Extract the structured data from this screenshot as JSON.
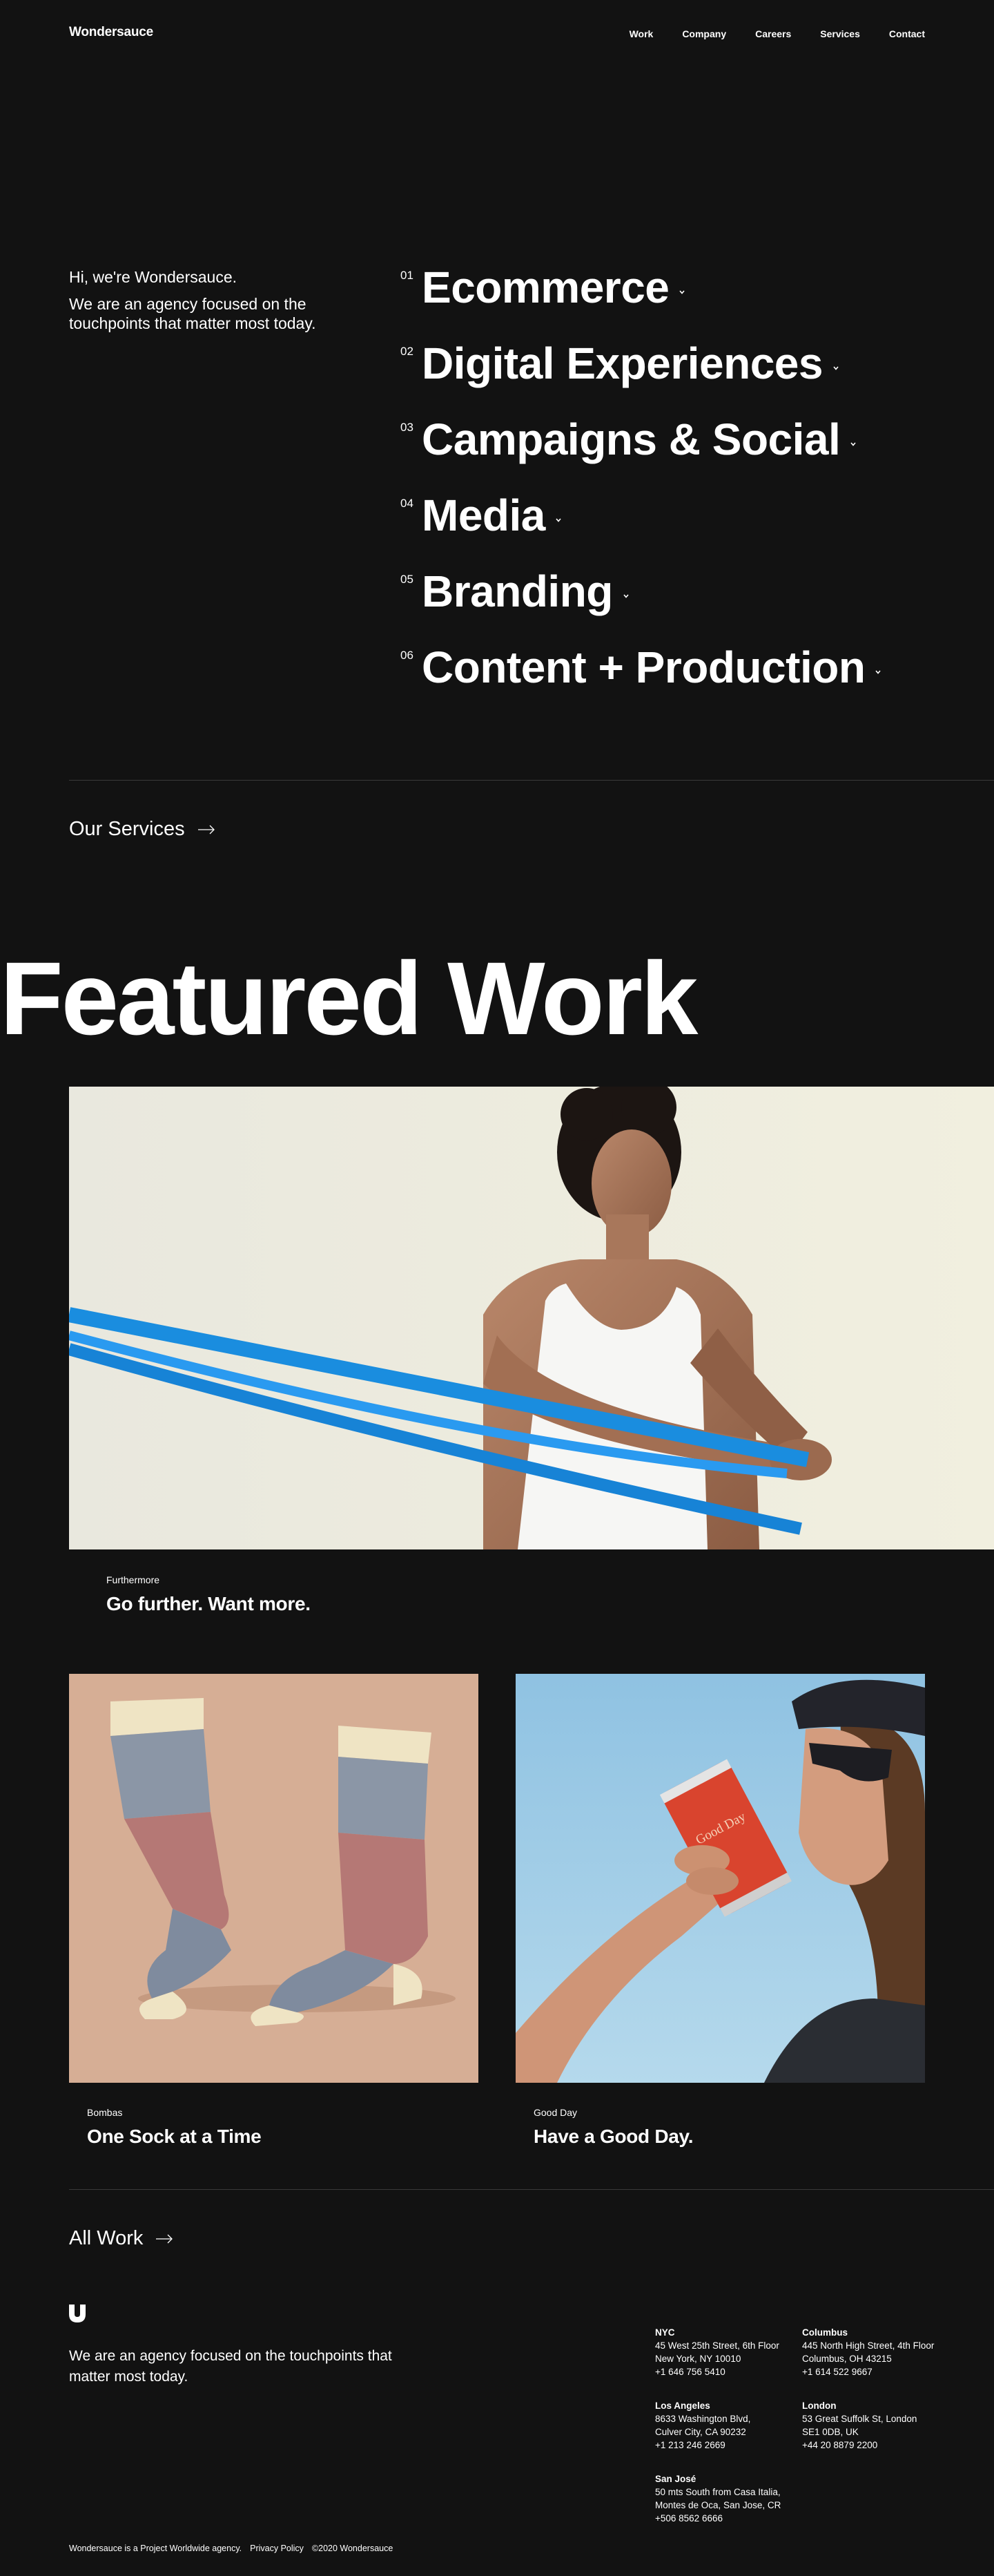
{
  "header": {
    "logo": "Wondersauce",
    "nav": [
      "Work",
      "Company",
      "Careers",
      "Services",
      "Contact"
    ]
  },
  "hero": {
    "greeting": "Hi, we're Wondersauce.",
    "description": "We are an agency focused on the touchpoints that matter most today."
  },
  "services": [
    {
      "num": "01",
      "title": "Ecommerce"
    },
    {
      "num": "02",
      "title": "Digital Experiences"
    },
    {
      "num": "03",
      "title": "Campaigns & Social"
    },
    {
      "num": "04",
      "title": "Media"
    },
    {
      "num": "05",
      "title": "Branding"
    },
    {
      "num": "06",
      "title": "Content + Production"
    }
  ],
  "our_services_link": "Our Services",
  "featured_title": "Featured Work",
  "cases": [
    {
      "client": "Furthermore",
      "title": "Go further. Want more."
    },
    {
      "client": "Bombas",
      "title": "One Sock at a Time"
    },
    {
      "client": "Good Day",
      "title": "Have a Good Day."
    }
  ],
  "all_work_link": "All Work",
  "footer": {
    "description": "We are an agency focused on the touchpoints that matter most today.",
    "offices": [
      {
        "city": "NYC",
        "lines": [
          "45 West 25th Street, 6th Floor",
          "New York, NY 10010",
          "+1 646 756 5410"
        ]
      },
      {
        "city": "Columbus",
        "lines": [
          "445 North High Street, 4th Floor",
          "Columbus, OH 43215",
          "+1 614 522 9667"
        ]
      },
      {
        "city": "Los Angeles",
        "lines": [
          "8633 Washington Blvd,",
          "Culver City, CA 90232",
          "+1 213 246 2669"
        ]
      },
      {
        "city": "London",
        "lines": [
          "53 Great Suffolk St, London",
          "SE1 0DB, UK",
          "+44 20 8879 2200"
        ]
      },
      {
        "city": "San José",
        "lines": [
          "50 mts South from Casa Italia,",
          "Montes de Oca, San Jose, CR",
          "+506 8562 6666"
        ]
      }
    ],
    "legal": "Wondersauce is a Project Worldwide agency.",
    "privacy": "Privacy Policy",
    "copyright": "©2020 Wondersauce"
  },
  "can_text": "Good Day Have a Good Day",
  "colors": {
    "background": "#121212",
    "text": "#ffffff",
    "rule": "#3a3a3a"
  }
}
